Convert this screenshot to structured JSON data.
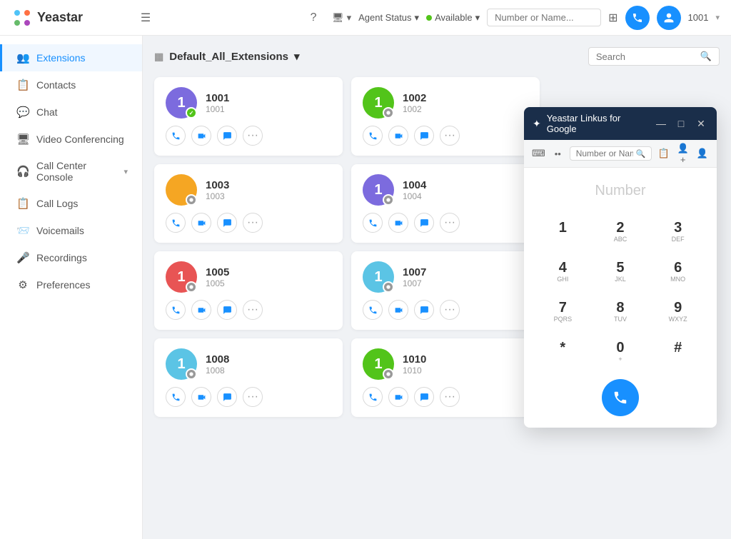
{
  "app": {
    "title": "Yeastar",
    "menu_icon": "☰"
  },
  "topbar": {
    "help_label": "?",
    "monitor_label": "Monitor",
    "agent_status_label": "Agent Status",
    "available_label": "Available",
    "search_placeholder": "Number or Name...",
    "user_label": "1001",
    "call_icon": "📞",
    "user_icon": "👤"
  },
  "sidebar": {
    "items": [
      {
        "id": "extensions",
        "label": "Extensions",
        "icon": "👥",
        "active": true
      },
      {
        "id": "contacts",
        "label": "Contacts",
        "icon": "📋",
        "active": false
      },
      {
        "id": "chat",
        "label": "Chat",
        "icon": "💬",
        "active": false
      },
      {
        "id": "video-conferencing",
        "label": "Video Conferencing",
        "icon": "🖥",
        "active": false
      },
      {
        "id": "call-center",
        "label": "Call Center Console",
        "icon": "🎧",
        "active": false,
        "has_chevron": true
      },
      {
        "id": "call-logs",
        "label": "Call Logs",
        "icon": "📋",
        "active": false
      },
      {
        "id": "voicemails",
        "label": "Voicemails",
        "icon": "📨",
        "active": false
      },
      {
        "id": "recordings",
        "label": "Recordings",
        "icon": "🎤",
        "active": false
      },
      {
        "id": "preferences",
        "label": "Preferences",
        "icon": "⚙",
        "active": false
      }
    ]
  },
  "content": {
    "group_selector": {
      "label": "Default_All_Extensions",
      "chevron": "▾"
    },
    "search_placeholder": "Search"
  },
  "extensions": [
    {
      "id": "1001",
      "number": "1001",
      "sub": "1001",
      "avatar_letter": "1",
      "avatar_color": "#7c6bde",
      "status": "available",
      "status_icon": "✓"
    },
    {
      "id": "1002",
      "number": "1002",
      "sub": "1002",
      "avatar_letter": "1",
      "avatar_color": "#52c41a",
      "status": "dnd",
      "status_icon": ""
    },
    {
      "id": "1003",
      "number": "1003",
      "sub": "1003",
      "avatar_letter": "",
      "avatar_color": "#f5a623",
      "status": "default",
      "status_icon": ""
    },
    {
      "id": "1004",
      "number": "1004",
      "sub": "1004",
      "avatar_letter": "1",
      "avatar_color": "#7c6bde",
      "status": "default",
      "status_icon": ""
    },
    {
      "id": "1005",
      "number": "1005",
      "sub": "1005",
      "avatar_letter": "1",
      "avatar_color": "#e85454",
      "status": "default",
      "status_icon": ""
    },
    {
      "id": "1007",
      "number": "1007",
      "sub": "1007",
      "avatar_letter": "1",
      "avatar_color": "#5bc4e5",
      "status": "default",
      "status_icon": ""
    },
    {
      "id": "1008",
      "number": "1008",
      "sub": "1008",
      "avatar_letter": "1",
      "avatar_color": "#5bc4e5",
      "status": "default",
      "status_icon": ""
    },
    {
      "id": "1010",
      "number": "1010",
      "sub": "1010",
      "avatar_letter": "1",
      "avatar_color": "#52c41a",
      "status": "default",
      "status_icon": ""
    }
  ],
  "dialer": {
    "title": "Yeastar Linkus for Google",
    "number_placeholder": "Number",
    "keys": [
      {
        "num": "1",
        "letters": ""
      },
      {
        "num": "2",
        "letters": "ABC"
      },
      {
        "num": "3",
        "letters": "DEF"
      },
      {
        "num": "4",
        "letters": "GHI"
      },
      {
        "num": "5",
        "letters": "JKL"
      },
      {
        "num": "6",
        "letters": "MNO"
      },
      {
        "num": "7",
        "letters": "PQRS"
      },
      {
        "num": "8",
        "letters": "TUV"
      },
      {
        "num": "9",
        "letters": "WXYZ"
      },
      {
        "num": "*",
        "letters": ""
      },
      {
        "num": "0",
        "letters": "+"
      },
      {
        "num": "#",
        "letters": ""
      }
    ],
    "minimize_label": "—",
    "maximize_label": "□",
    "close_label": "✕"
  }
}
